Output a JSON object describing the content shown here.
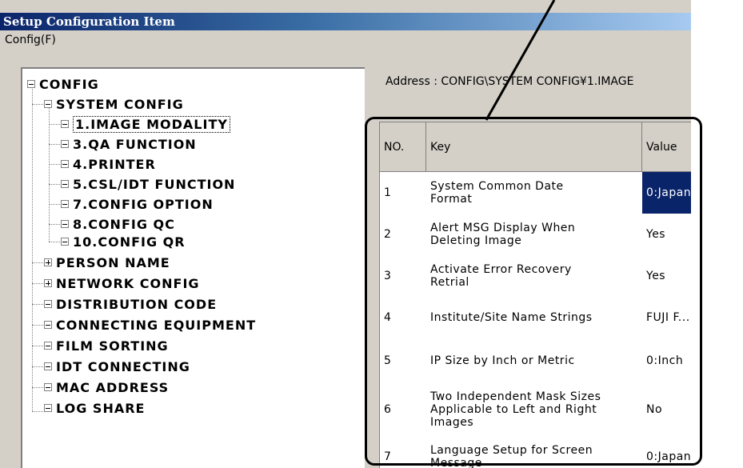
{
  "window": {
    "title": "Setup Configuration Item"
  },
  "menu": {
    "config_label": "Config(F)"
  },
  "tree": {
    "root": "CONFIG",
    "system_config": "SYSTEM CONFIG",
    "children": [
      "1.IMAGE MODALITY",
      "3.QA FUNCTION",
      "4.PRINTER",
      "5.CSL/IDT FUNCTION",
      "7.CONFIG OPTION",
      "8.CONFIG QC",
      "10.CONFIG QR"
    ],
    "groups": [
      "PERSON NAME",
      "NETWORK CONFIG",
      "DISTRIBUTION CODE",
      "CONNECTING EQUIPMENT",
      "FILM SORTING",
      "IDT CONNECTING",
      "MAC ADDRESS",
      "LOG SHARE"
    ],
    "selected": "1.IMAGE MODALITY"
  },
  "address": {
    "text": "Address :  CONFIG\\SYSTEM CONFIG¥1.IMAGE"
  },
  "table": {
    "headers": [
      "NO.",
      "Key",
      "Value"
    ],
    "rows": [
      {
        "no": "1",
        "key": "System Common Date Format",
        "value": "0:Japan"
      },
      {
        "no": "2",
        "key": "Alert MSG Display When Deleting Image",
        "value": "Yes"
      },
      {
        "no": "3",
        "key": "Activate Error Recovery Retrial",
        "value": "Yes"
      },
      {
        "no": "4",
        "key": "Institute/Site Name Strings",
        "value": "FUJI F..."
      },
      {
        "no": "5",
        "key": "IP Size by Inch or Metric",
        "value": "0:Inch"
      },
      {
        "no": "6",
        "key": "Two Independent Mask Sizes Applicable to Left and Right Images",
        "value": "No"
      },
      {
        "no": "7",
        "key": "Language Setup for Screen Message",
        "value": "0:Japan"
      }
    ]
  },
  "colors": {
    "selection": "#0a246a",
    "title_gradient_start": "#0a246a",
    "title_gradient_end": "#a6caf0",
    "face": "#d4d0c8"
  }
}
